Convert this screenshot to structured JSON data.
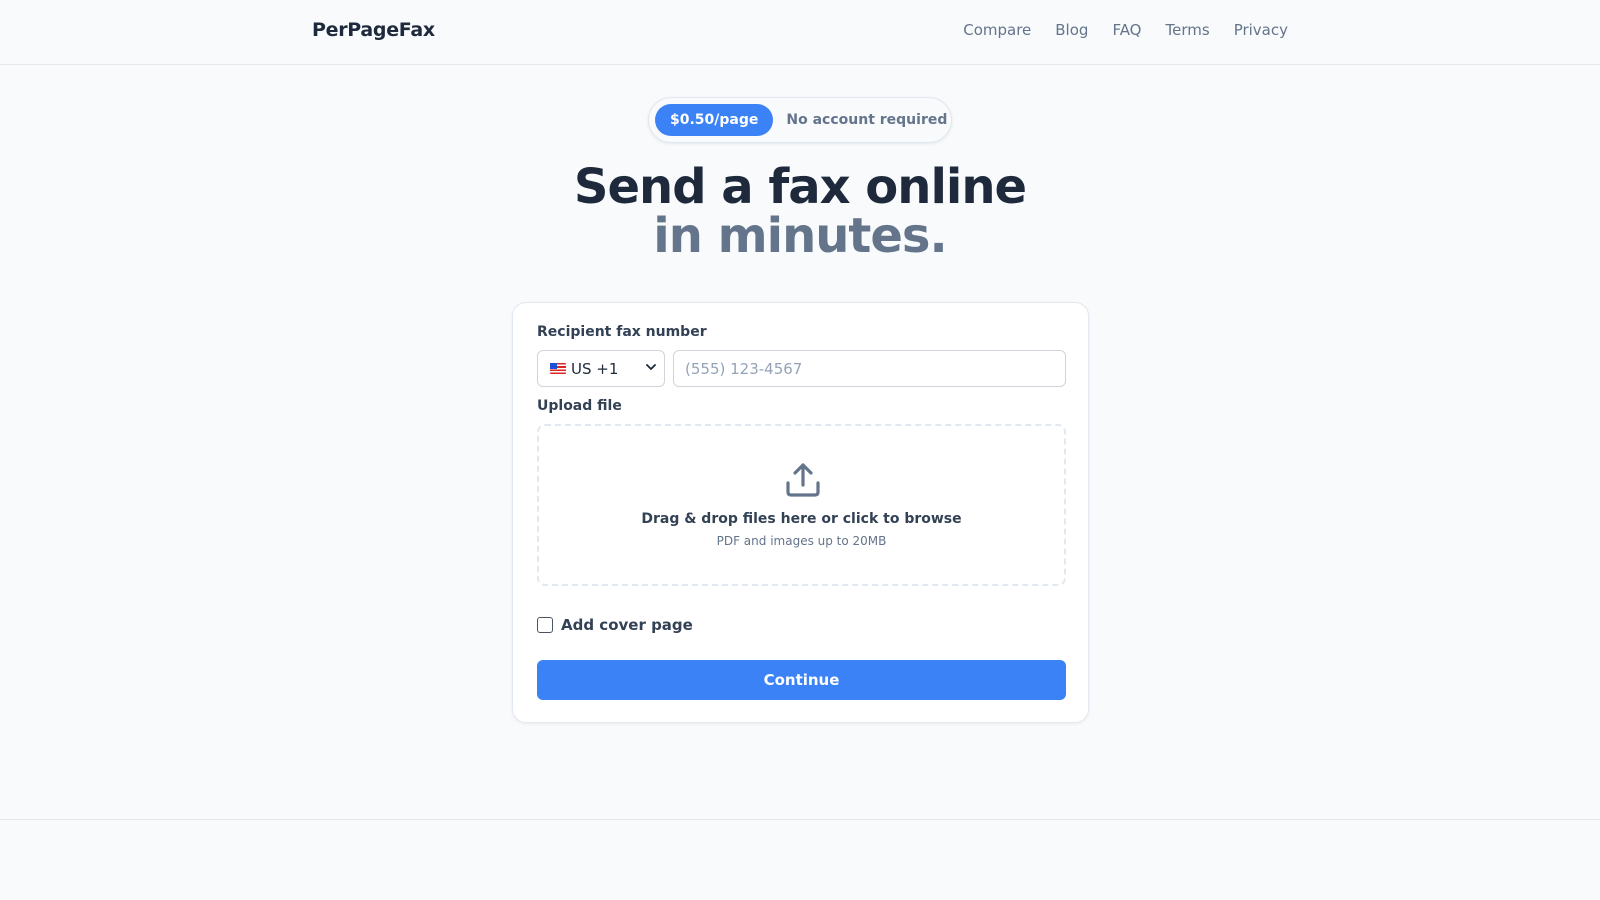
{
  "header": {
    "logo": "PerPageFax",
    "nav": [
      "Compare",
      "Blog",
      "FAQ",
      "Terms",
      "Privacy"
    ]
  },
  "hero": {
    "price_badge": "$0.50/page",
    "note": "No account required",
    "headline_line1": "Send a fax online",
    "headline_line2": "in minutes."
  },
  "form": {
    "recipient_label": "Recipient fax number",
    "country_value": "US +1",
    "fax_placeholder": "(555) 123-4567",
    "upload_label": "Upload file",
    "drop_title": "Drag & drop files here or click to browse",
    "drop_sub": "PDF and images up to 20MB",
    "cover_page_label": "Add cover page",
    "cover_page_checked": false,
    "continue_label": "Continue"
  },
  "icons": {
    "flag": "us-flag-icon",
    "select": "chevron-down-icon",
    "upload": "upload-icon"
  },
  "colors": {
    "accent": "#3b82f6",
    "text_dark": "#1e293b",
    "text_muted": "#64748b",
    "background": "#f8fafc"
  }
}
